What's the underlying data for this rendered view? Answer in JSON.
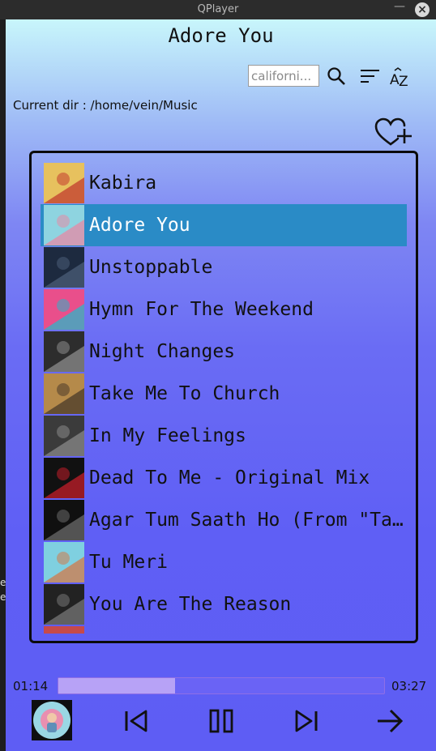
{
  "window": {
    "title": "QPlayer",
    "minimize_glyph": "—",
    "close_glyph": "×"
  },
  "player": {
    "song_title": "Adore You",
    "current_dir": "Current dir : /home/vein/Music"
  },
  "search": {
    "value": "californi..."
  },
  "toolbar": {
    "icons": [
      "search-icon",
      "sort-icon",
      "sort-az-icon",
      "heart-plus-icon"
    ]
  },
  "playlist": {
    "selected_index": 1,
    "items": [
      {
        "name": "Kabira",
        "art_colors": [
          "#e7c15e",
          "#c23b2f"
        ]
      },
      {
        "name": "Adore You",
        "art_colors": [
          "#8ed4e0",
          "#e58aa6"
        ]
      },
      {
        "name": "Unstoppable",
        "art_colors": [
          "#1d2a3f",
          "#4b5d78"
        ]
      },
      {
        "name": "Hymn For The Weekend",
        "art_colors": [
          "#e94f8b",
          "#2bb5c8"
        ]
      },
      {
        "name": "Night Changes",
        "art_colors": [
          "#2d2d2d",
          "#8c8c8c"
        ]
      },
      {
        "name": "Take Me To Church",
        "art_colors": [
          "#b58a4a",
          "#4a3a2a"
        ]
      },
      {
        "name": "In My Feelings",
        "art_colors": [
          "#3b3b3b",
          "#8a8a8a"
        ]
      },
      {
        "name": "Dead To Me - Original Mix",
        "art_colors": [
          "#111111",
          "#c41e2a"
        ]
      },
      {
        "name": "Agar Tum Saath Ho (From \"Ta…",
        "art_colors": [
          "#101010",
          "#6a6a6a"
        ]
      },
      {
        "name": "Tu Meri",
        "art_colors": [
          "#7fd0e0",
          "#d27a4a"
        ]
      },
      {
        "name": "You Are The Reason",
        "art_colors": [
          "#222222",
          "#777777"
        ]
      },
      {
        "name": "",
        "art_colors": [
          "#c64a4a",
          "#ffffff"
        ]
      }
    ]
  },
  "progress": {
    "elapsed": "01:14",
    "total": "03:27",
    "fraction": 0.357
  },
  "controls": {
    "icons": [
      "previous-icon",
      "pause-icon",
      "next-icon",
      "forward-arrow-icon"
    ]
  },
  "colors": {
    "selected_row": "#2a8bc6",
    "progress_fill": "#b7a2f6"
  }
}
